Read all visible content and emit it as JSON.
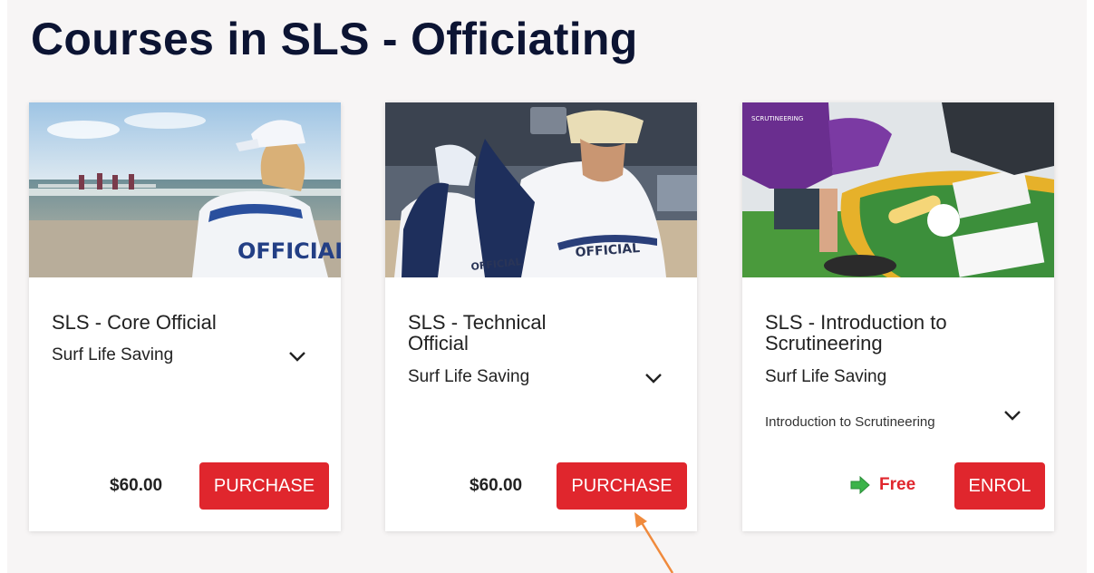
{
  "page": {
    "title": "Courses in SLS - Officiating"
  },
  "courses": [
    {
      "title": "SLS - Core Official",
      "provider": "Surf Life Saving",
      "description": "",
      "price": "$60.00",
      "action_label": "PURCHASE",
      "image_text": "OFFICIAL"
    },
    {
      "title": "SLS - Technical Official",
      "provider": "Surf Life Saving",
      "description": "",
      "price": "$60.00",
      "action_label": "PURCHASE",
      "image_text": "OFFICIAL"
    },
    {
      "title": "SLS - Introduction to Scrutineering",
      "provider": "Surf Life Saving",
      "description": "Introduction to Scrutineering",
      "price": "Free",
      "action_label": "ENROL",
      "image_text": "SCRUTINEERING"
    }
  ],
  "colors": {
    "title": "#0c1433",
    "button": "#e0262d",
    "free_text": "#e0262d",
    "free_arrow": "#3bb34a",
    "annotation_arrow": "#f08a3c"
  },
  "icons": {
    "expand": "chevron-down-icon",
    "free": "arrow-right-icon"
  }
}
